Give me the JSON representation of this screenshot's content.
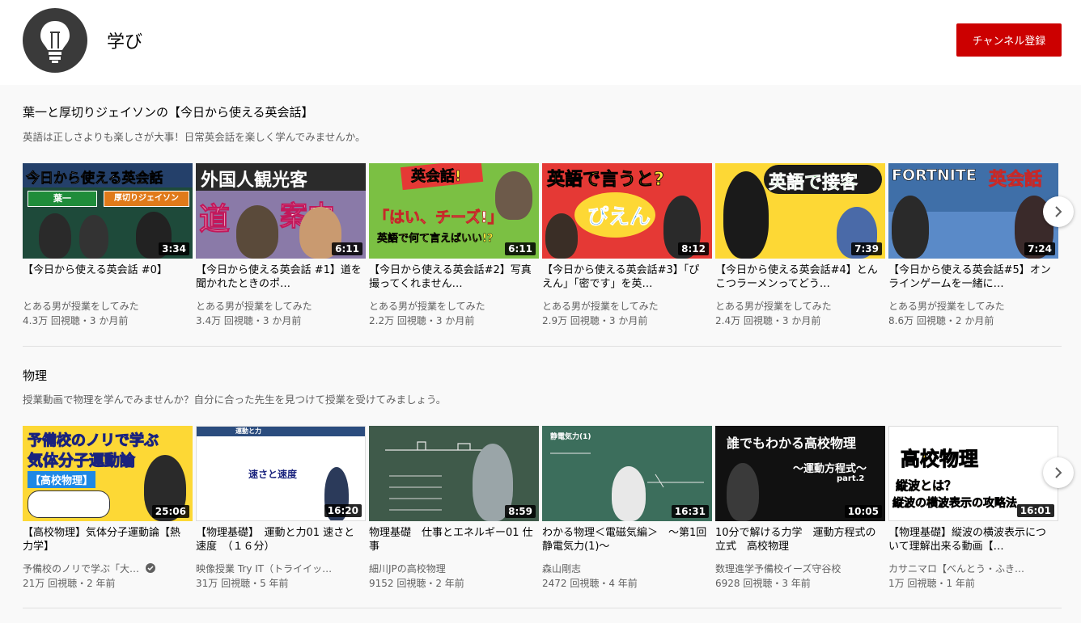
{
  "header": {
    "channel_name": "学び",
    "subscribe_label": "チャンネル登録"
  },
  "sections": [
    {
      "title": "葉一と厚切りジェイソンの【今日から使える英会話】",
      "description": "英語は正しさよりも楽しさが大事！日常英会話を楽しく学んでみませんか。",
      "videos": [
        {
          "title": "【今日から使える英会話 #0】",
          "channel": "とある男が授業をしてみた",
          "meta": "4.3万 回視聴・3 か月前",
          "duration": "3:34",
          "thumb_text": "今日から使える英会話",
          "thumb_sub1": "葉一",
          "thumb_sub2": "厚切りジェイソン"
        },
        {
          "title": "【今日から使える英会話 #1】道を聞かれたときのポ…",
          "channel": "とある男が授業をしてみた",
          "meta": "3.4万 回視聴・3 か月前",
          "duration": "6:11",
          "thumb_text": "外国人観光客",
          "thumb_sub1": "道",
          "thumb_sub2": "案内"
        },
        {
          "title": "【今日から使える英会話#2】写真撮ってくれません…",
          "channel": "とある男が授業をしてみた",
          "meta": "2.2万 回視聴・3 か月前",
          "duration": "6:11",
          "thumb_text": "英会話!",
          "thumb_sub1": "「はい、チーズ!」",
          "thumb_sub2": "英語で何て言えばいい!?"
        },
        {
          "title": "【今日から使える英会話#3】「ぴえん」「密です」を英…",
          "channel": "とある男が授業をしてみた",
          "meta": "2.9万 回視聴・3 か月前",
          "duration": "8:12",
          "thumb_text": "英語で言うと?",
          "thumb_sub1": "ぴえん",
          "thumb_sub2": ""
        },
        {
          "title": "【今日から使える英会話#4】とんこつラーメンってどう…",
          "channel": "とある男が授業をしてみた",
          "meta": "2.4万 回視聴・3 か月前",
          "duration": "7:39",
          "thumb_text": "英語で接客",
          "thumb_sub1": "",
          "thumb_sub2": ""
        },
        {
          "title": "【今日から使える英会話#5】オンラインゲームを一緒に…",
          "channel": "とある男が授業をしてみた",
          "meta": "8.6万 回視聴・2 か月前",
          "duration": "7:24",
          "thumb_text": "FORTNITE",
          "thumb_sub1": "英会話",
          "thumb_sub2": ""
        }
      ]
    },
    {
      "title": "物理",
      "description": "授業動画で物理を学んでみませんか？自分に合った先生を見つけて授業を受けてみましょう。",
      "videos": [
        {
          "title": "【高校物理】気体分子運動論【熱力学】",
          "channel": "予備校のノリで学ぶ「大…",
          "meta": "21万 回視聴・2 年前",
          "duration": "25:06",
          "thumb_text": "予備校のノリで学ぶ",
          "thumb_sub1": "気体分子運動論",
          "thumb_sub2": "【高校物理】"
        },
        {
          "title": "【物理基礎】　運動と力01 速さと速度　（１６分）",
          "channel": "映像授業 Try IT（トライイッ…",
          "meta": "31万 回視聴・5 年前",
          "duration": "16:20",
          "thumb_text": "速さと速度",
          "thumb_sub1": "運動と力",
          "thumb_sub2": ""
        },
        {
          "title": "物理基礎　仕事とエネルギー01 仕事",
          "channel": "細川JPの高校物理",
          "meta": "9152 回視聴・2 年前",
          "duration": "8:59",
          "thumb_text": "",
          "thumb_sub1": "",
          "thumb_sub2": ""
        },
        {
          "title": "わかる物理＜電磁気編＞　～第1回　静電気力(1)～",
          "channel": "森山剛志",
          "meta": "2472 回視聴・4 年前",
          "duration": "16:31",
          "thumb_text": "静電気力(1)",
          "thumb_sub1": "",
          "thumb_sub2": ""
        },
        {
          "title": "10分で解ける力学　運動方程式の立式　高校物理",
          "channel": "数理進学予備校イーズ守谷校",
          "meta": "6928 回視聴・3 年前",
          "duration": "10:05",
          "thumb_text": "誰でもわかる高校物理",
          "thumb_sub1": "〜運動方程式〜",
          "thumb_sub2": "part.2"
        },
        {
          "title": "【物理基礎】縦波の横波表示について理解出来る動画【…",
          "channel": "カサニマロ【べんとう・ふき…",
          "meta": "1万 回視聴・1 年前",
          "duration": "16:01",
          "thumb_text": "高校物理",
          "thumb_sub1": "縦波とは？",
          "thumb_sub2": "縦波の横波表示の攻略法"
        }
      ]
    }
  ],
  "colors": {
    "accent": "#cc0000",
    "verified": "#606060"
  },
  "icons": [
    "lightbulb-icon",
    "chevron-right-icon",
    "verified-icon"
  ]
}
